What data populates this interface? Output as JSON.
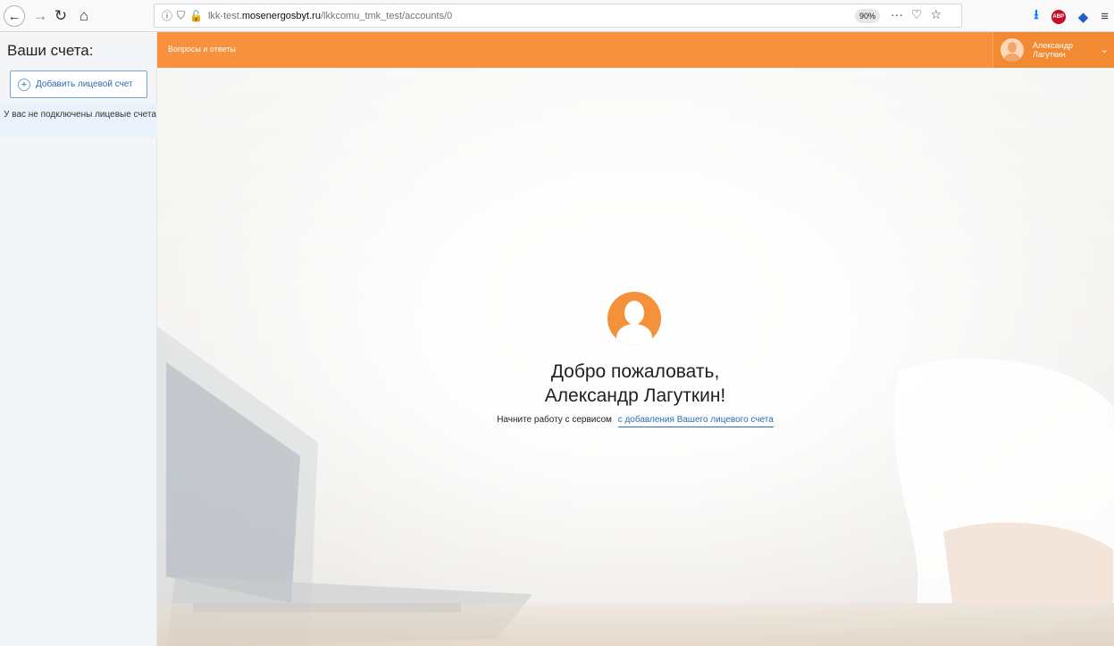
{
  "browser": {
    "url_prefix": "lkk-test.",
    "url_host": "mosenergosbyt.ru",
    "url_path": "/lkkcomu_tmk_test/accounts/0",
    "zoom": "90%",
    "page_actions": "···",
    "abp_label": "ABP"
  },
  "sidebar": {
    "title": "Ваши счета:",
    "add_button_label": "Добавить лицевой счет",
    "empty_message": "У вас не подключены лицевые счета"
  },
  "header": {
    "faq_link": "Вопросы и ответы",
    "user_first_name": "Александр",
    "user_last_name": "Лагуткин"
  },
  "welcome": {
    "title_line1": "Добро пожаловать,",
    "title_line2": "Александр Лагуткин!",
    "subtitle_prefix": "Начните работу с сервисом",
    "subtitle_link": "с добавления Вашего лицевого счета"
  },
  "colors": {
    "brand_orange": "#f7913d",
    "link_blue": "#2a6db3",
    "sidebar_bg": "#f4f5f7"
  }
}
